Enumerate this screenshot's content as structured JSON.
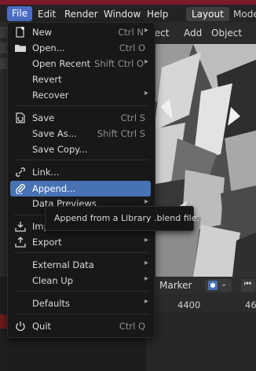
{
  "menubar": {
    "file": "File",
    "edit": "Edit",
    "render": "Render",
    "window": "Window",
    "help": "Help",
    "tab_layout": "Layout",
    "tab_modeling": "Mode"
  },
  "viewport_header": {
    "select": "elect",
    "add": "Add",
    "object": "Object"
  },
  "timeline": {
    "marker": "Marker",
    "frame_4400": "4400",
    "frame_next": "46"
  },
  "file_menu": {
    "items": [
      {
        "label": "New",
        "shortcut": "Ctrl N",
        "submenu": true,
        "icon": "new-file-icon"
      },
      {
        "label": "Open...",
        "shortcut": "Ctrl O",
        "submenu": false,
        "icon": "folder-icon"
      },
      {
        "label": "Open Recent",
        "shortcut": "Shift Ctrl O",
        "submenu": true,
        "icon": ""
      },
      {
        "label": "Revert",
        "shortcut": "",
        "submenu": false,
        "icon": ""
      },
      {
        "label": "Recover",
        "shortcut": "",
        "submenu": true,
        "icon": ""
      },
      {
        "label": "Save",
        "shortcut": "Ctrl S",
        "submenu": false,
        "icon": "save-icon"
      },
      {
        "label": "Save As...",
        "shortcut": "Shift Ctrl S",
        "submenu": false,
        "icon": ""
      },
      {
        "label": "Save Copy...",
        "shortcut": "",
        "submenu": false,
        "icon": ""
      },
      {
        "label": "Link...",
        "shortcut": "",
        "submenu": false,
        "icon": "link-icon"
      },
      {
        "label": "Append...",
        "shortcut": "",
        "submenu": false,
        "icon": "paperclip-icon"
      },
      {
        "label": "Data Previews",
        "shortcut": "",
        "submenu": true,
        "icon": ""
      },
      {
        "label": "Import",
        "shortcut": "",
        "submenu": true,
        "icon": "import-icon"
      },
      {
        "label": "Export",
        "shortcut": "",
        "submenu": true,
        "icon": "export-icon"
      },
      {
        "label": "External Data",
        "shortcut": "",
        "submenu": true,
        "icon": ""
      },
      {
        "label": "Clean Up",
        "shortcut": "",
        "submenu": true,
        "icon": ""
      },
      {
        "label": "Defaults",
        "shortcut": "",
        "submenu": true,
        "icon": ""
      },
      {
        "label": "Quit",
        "shortcut": "Ctrl Q",
        "submenu": false,
        "icon": "power-icon"
      }
    ],
    "active_item": "Append..."
  },
  "tooltip": {
    "text": "Append from a Library .blend file."
  },
  "colors": {
    "accent": "#4772b3",
    "menu_bg": "#181818",
    "top_strip": "#7a1a2a"
  }
}
